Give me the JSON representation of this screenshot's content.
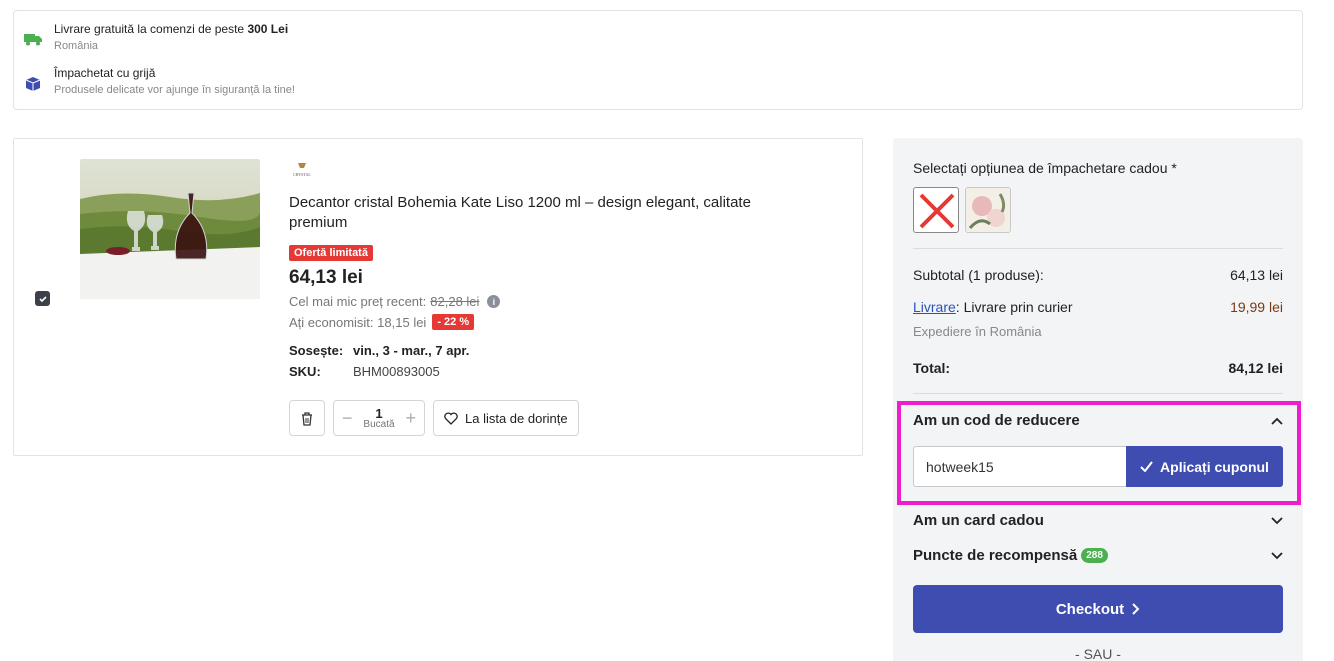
{
  "info": {
    "shipping_title_prefix": "Livrare gratuită la comenzi de peste",
    "shipping_title_amount": "300 Lei",
    "shipping_sub": "România",
    "packed_title": "Împachetat cu grijă",
    "packed_sub": "Produsele delicate vor ajunge în siguranță la tine!",
    "shipping_icon": "truck-icon",
    "packed_icon": "box-icon",
    "icon_color_shipping": "#4caf50",
    "icon_color_packed": "#3f4db0"
  },
  "product": {
    "brand": "CRYSTAL",
    "title": "Decantor cristal Bohemia Kate Liso 1200 ml – design elegant, calitate premium",
    "offer_badge": "Ofertă limitată",
    "price": "64,13 lei",
    "recent_label": "Cel mai mic preț recent:",
    "recent_old_price": "82,28 lei",
    "save_label": "Ați economisit:",
    "save_amount": "18,15 lei",
    "discount": "- 22 %",
    "delivery_label": "Sosește:",
    "delivery_value": "vin., 3 - mar., 7 apr.",
    "sku_label": "SKU:",
    "sku_value": "BHM00893005",
    "quantity": "1",
    "quantity_unit": "Bucată",
    "wishlist_label": "La lista de dorințe",
    "checked": true
  },
  "summary": {
    "gift_label": "Selectați opțiunea de împachetare cadou *",
    "subtotal_label": "Subtotal (1 produse):",
    "subtotal_value": "64,13 lei",
    "shipping_link": "Livrare",
    "shipping_label": ": Livrare prin curier",
    "shipping_value": "19,99 lei",
    "shipping_sub": "Expediere în România",
    "total_label": "Total:",
    "total_value": "84,12 lei",
    "coupon_heading": "Am un cod de reducere",
    "coupon_value": "hotweek15",
    "coupon_button": "Aplicați cuponul",
    "gift_card_heading": "Am un card cadou",
    "points_heading": "Puncte de recompensă",
    "points_badge": "288",
    "checkout_button": "Checkout",
    "or_text": "- SAU -",
    "accent_color": "#3f4db0",
    "highlight_color": "#ee1ecc"
  }
}
